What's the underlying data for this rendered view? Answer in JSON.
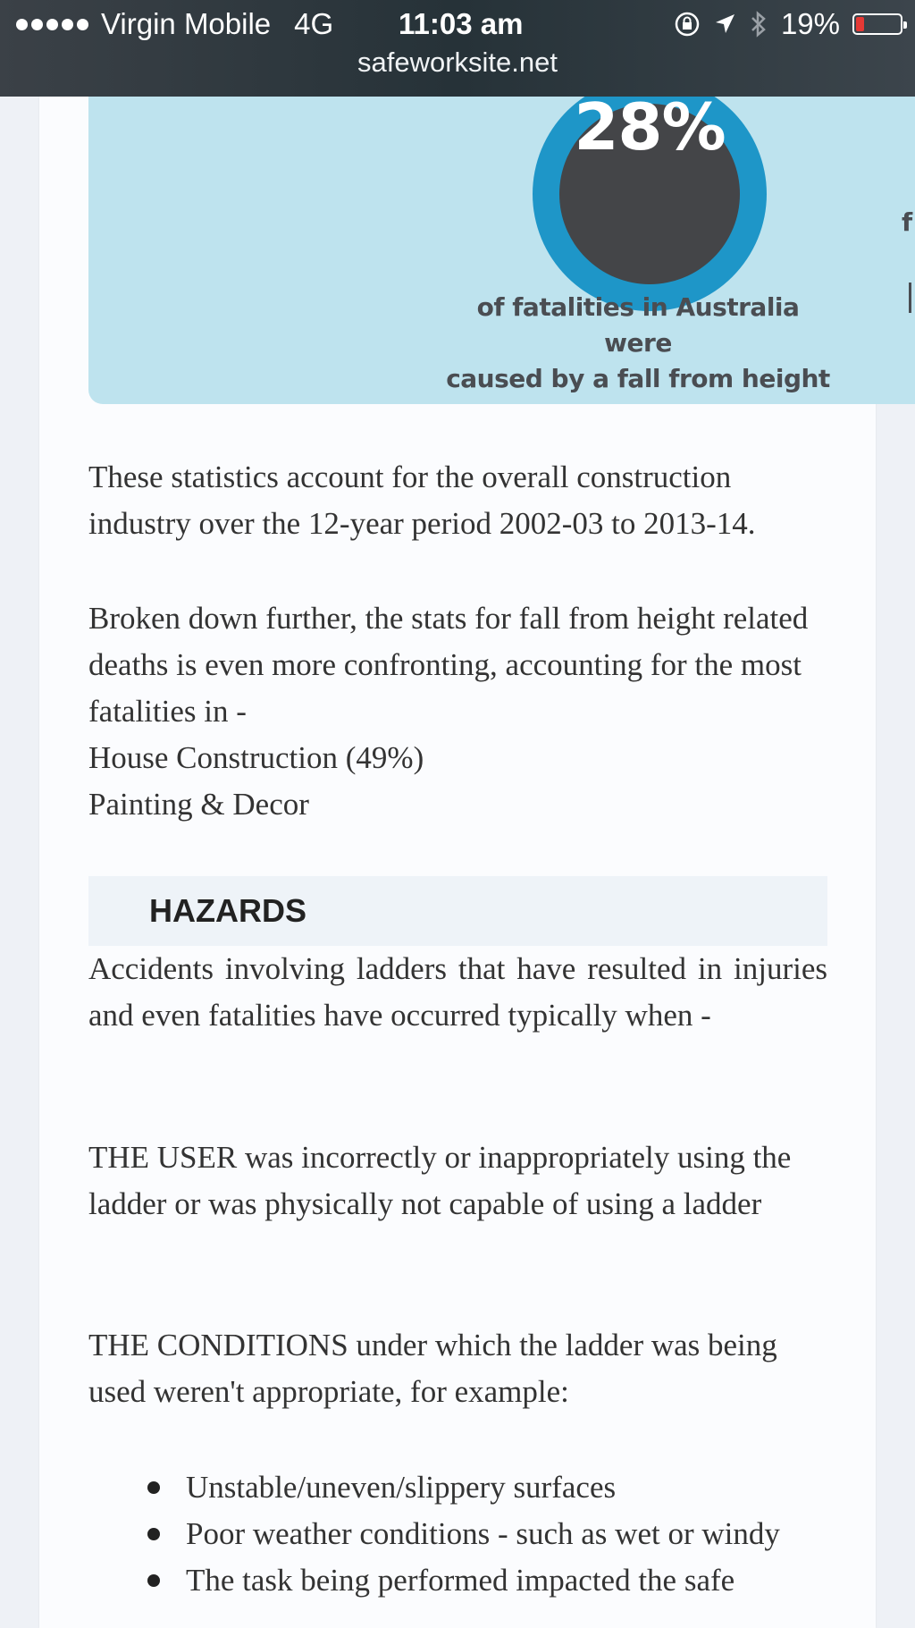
{
  "status_bar": {
    "carrier": "Virgin Mobile",
    "network": "4G",
    "time": "11:03 am",
    "battery": "19%",
    "battery_level": 0.19,
    "url": "safeworksite.net"
  },
  "infographic": {
    "percent": "28%",
    "caption_line1": "of fatalities in Australia were",
    "caption_line2": "caused by a fall from height",
    "edge_letter": "f"
  },
  "content": {
    "para1": "These statistics account for the overall construction industry over the 12-year period 2002-03 to 2013-14.",
    "para2": "Broken down further, the stats for fall from height related deaths is even more confronting, accounting for the most fatalities in -",
    "para2_item1": "House Construction (49%)",
    "para2_item2": "Painting & Decor",
    "hazards_heading": "HAZARDS",
    "para3": "Accidents involving ladders that have resulted in injuries and even fatalities have occurred typically when -",
    "para4": "THE USER was incorrectly or inappropriately using the ladder or was physically not capable of using a ladder",
    "para5": "THE CONDITIONS under which the ladder was being used weren't appropriate, for example:",
    "bullets": [
      "Unstable/uneven/slippery surfaces",
      "Poor weather conditions - such as wet or windy",
      "The task being performed impacted the safe"
    ]
  },
  "colors": {
    "status_bg": "#263238",
    "info_bg": "#bee3ee",
    "ring": "#1e96c8",
    "ring_center": "#444548",
    "battery_low": "#e53935"
  }
}
